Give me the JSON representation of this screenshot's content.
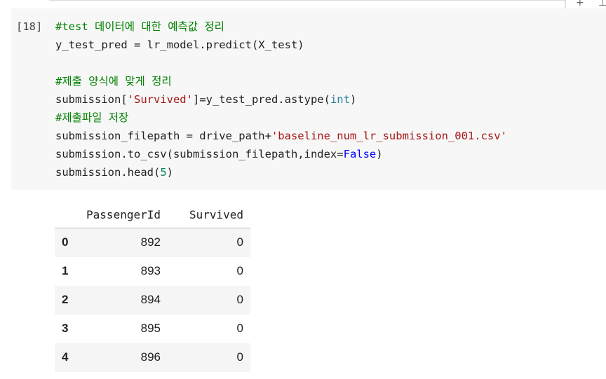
{
  "cell": {
    "execution_count": "[18]",
    "lines": [
      [
        {
          "t": "#test 데이터에 대한 예측값 정리",
          "c": "comment"
        }
      ],
      [
        {
          "t": "y_test_pred = lr_model.predict(X_test)",
          "c": ""
        }
      ],
      [],
      [
        {
          "t": "#제출 양식에 맞게 정리",
          "c": "comment"
        }
      ],
      [
        {
          "t": "submission[",
          "c": ""
        },
        {
          "t": "'Survived'",
          "c": "string"
        },
        {
          "t": "]=y_test_pred.astype(",
          "c": ""
        },
        {
          "t": "int",
          "c": "builtin"
        },
        {
          "t": ")",
          "c": ""
        }
      ],
      [
        {
          "t": "#제출파일 저장",
          "c": "comment"
        }
      ],
      [
        {
          "t": "submission_filepath = drive_path+",
          "c": ""
        },
        {
          "t": "'baseline_num_lr_submission_001.csv'",
          "c": "string"
        }
      ],
      [
        {
          "t": "submission.to_csv(submission_filepath,index=",
          "c": ""
        },
        {
          "t": "False",
          "c": "keyword"
        },
        {
          "t": ")",
          "c": ""
        }
      ],
      [
        {
          "t": "submission.head(",
          "c": ""
        },
        {
          "t": "5",
          "c": "number"
        },
        {
          "t": ")",
          "c": ""
        }
      ]
    ]
  },
  "output": {
    "columns": [
      "PassengerId",
      "Survived"
    ],
    "rows": [
      {
        "index": "0",
        "values": [
          "892",
          "0"
        ]
      },
      {
        "index": "1",
        "values": [
          "893",
          "0"
        ]
      },
      {
        "index": "2",
        "values": [
          "894",
          "0"
        ]
      },
      {
        "index": "3",
        "values": [
          "895",
          "0"
        ]
      },
      {
        "index": "4",
        "values": [
          "896",
          "0"
        ]
      }
    ]
  },
  "toolbar": {
    "add_icon": "plus-icon",
    "add_glyph": "+",
    "partial_glyph": "⊥"
  },
  "colors": {
    "cell_background": "#f7f7f7",
    "comment": "#008000",
    "string": "#a31515",
    "builtin": "#267f99",
    "keyword": "#0000ff",
    "number": "#098658",
    "table_stripe": "#f5f5f5"
  }
}
